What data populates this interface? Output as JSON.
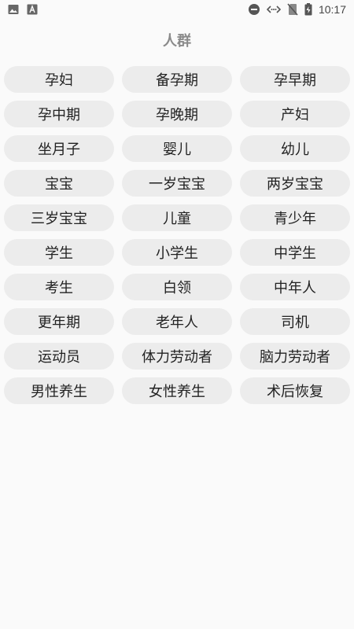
{
  "status_bar": {
    "time": "10:17",
    "icons_left": [
      "image-icon",
      "text-icon"
    ],
    "icons_right": [
      "do-not-disturb-icon",
      "data-saver-icon",
      "no-sim-icon",
      "battery-charging-icon"
    ]
  },
  "page": {
    "title": "人群"
  },
  "tags": [
    "孕妇",
    "备孕期",
    "孕早期",
    "孕中期",
    "孕晚期",
    "产妇",
    "坐月子",
    "婴儿",
    "幼儿",
    "宝宝",
    "一岁宝宝",
    "两岁宝宝",
    "三岁宝宝",
    "儿童",
    "青少年",
    "学生",
    "小学生",
    "中学生",
    "考生",
    "白领",
    "中年人",
    "更年期",
    "老年人",
    "司机",
    "运动员",
    "体力劳动者",
    "脑力劳动者",
    "男性养生",
    "女性养生",
    "术后恢复"
  ],
  "colors": {
    "background": "#fafafa",
    "tag_background": "#ececec",
    "title": "#8a8a8a"
  }
}
